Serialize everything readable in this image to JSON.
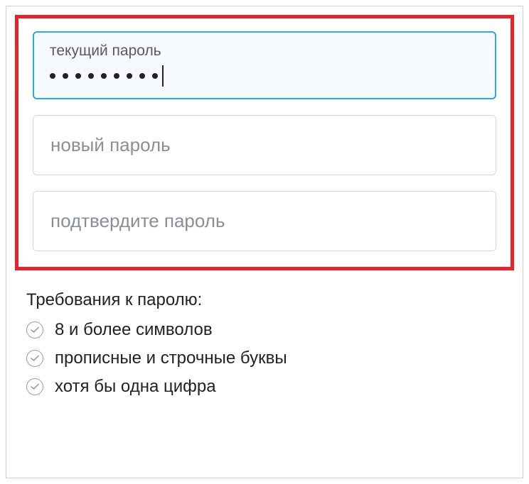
{
  "fields": {
    "current_password": {
      "label": "текущий пароль",
      "value_masked": "•••••••••",
      "dot_count": 9
    },
    "new_password": {
      "placeholder": "новый пароль"
    },
    "confirm_password": {
      "placeholder": "подтвердите пароль"
    }
  },
  "requirements": {
    "title": "Требования к паролю:",
    "items": [
      "8 и более символов",
      "прописные и строчные буквы",
      "хотя бы одна цифра"
    ]
  },
  "colors": {
    "highlight_border": "#e8232a",
    "focus_border": "#2aa8d6",
    "focus_bg": "#f5f9fc"
  }
}
